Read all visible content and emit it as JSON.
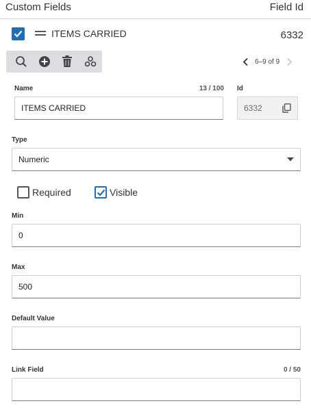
{
  "header": {
    "title": "Custom Fields",
    "right_label": "Field Id"
  },
  "item": {
    "name": "ITEMS CARRIED",
    "id": "6332",
    "checked": true
  },
  "toolbar": {
    "icons": [
      "search-icon",
      "add-circle-icon",
      "trash-icon",
      "settings-icon"
    ]
  },
  "pager": {
    "text": "6–9 of 9"
  },
  "form": {
    "name": {
      "label": "Name",
      "counter": "13 / 100",
      "value": "ITEMS CARRIED"
    },
    "id": {
      "label": "Id",
      "value": "6332"
    },
    "type": {
      "label": "Type",
      "value": "Numeric"
    },
    "required": {
      "label": "Required",
      "checked": false
    },
    "visible": {
      "label": "Visible",
      "checked": true
    },
    "min": {
      "label": "Min",
      "value": "0"
    },
    "max": {
      "label": "Max",
      "value": "500"
    },
    "default_value": {
      "label": "Default Value",
      "value": ""
    },
    "link_field": {
      "label": "Link Field",
      "counter": "0 / 50",
      "value": ""
    }
  },
  "colors": {
    "accent": "#1f6fb6",
    "toolbar_bg": "#dcdde0"
  }
}
